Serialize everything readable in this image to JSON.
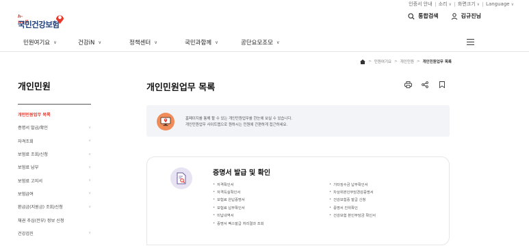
{
  "utility": {
    "cert": "인증서 안내",
    "sound": "소리",
    "zoom": "화면크기",
    "language": "Language"
  },
  "logo": {
    "tagline": "h-well",
    "name": "국민건강보험"
  },
  "header": {
    "search_label": "통합검색",
    "user_label": "김규진님"
  },
  "gnb": {
    "items": [
      "민원여기요",
      "건강iN",
      "정책센터",
      "국민과함께",
      "공단요모조모"
    ]
  },
  "breadcrumb": {
    "items": [
      "민원여기요",
      "개인민원",
      "개인민원업무 목록"
    ]
  },
  "sidebar": {
    "title": "개인민원",
    "items": [
      {
        "label": "개인민원업무 목록",
        "active": true,
        "chevron": false
      },
      {
        "label": "증명서 발급/확인",
        "active": false,
        "chevron": true
      },
      {
        "label": "자격조회",
        "active": false,
        "chevron": true
      },
      {
        "label": "보험료 조회/신청",
        "active": false,
        "chevron": true
      },
      {
        "label": "보험료 납부",
        "active": false,
        "chevron": true
      },
      {
        "label": "보험료 고지서",
        "active": false,
        "chevron": true
      },
      {
        "label": "보험급여",
        "active": false,
        "chevron": true
      },
      {
        "label": "환급금(지원금) 조회/신청",
        "active": false,
        "chevron": true
      },
      {
        "label": "채권 추심(전부) 정보 신청",
        "active": false,
        "chevron": false
      },
      {
        "label": "건강검진",
        "active": false,
        "chevron": true
      }
    ]
  },
  "main": {
    "title": "개인민원업무 목록",
    "notice": {
      "line1": "홈페이지를 통해 할 수 있는 개인민원업무를 한눈에 보실 수 있습니다.",
      "line2": "개인민원업무 사이트맵으로 원하시는 민원에 간편하게 접근하세요."
    },
    "card": {
      "title": "증명서 발급 및 확인",
      "left_items": [
        "자격확인서",
        "자격득실확인서",
        "보험료 완납증명서",
        "보험료 납부확인서",
        "미납내역서",
        "증명서 팩스발급 처리결과 조회"
      ],
      "right_items": [
        "기타징수금 납부확인서",
        "차상위본인부담경감증명서",
        "건강보험증 발급 신청",
        "증명서 진위확인",
        "건강보험 본인부담금 확인서"
      ]
    }
  },
  "colors": {
    "accent_red": "#e8372c",
    "brand_navy": "#1f3e7a",
    "notice_bg": "#f2f4f8",
    "notice_icon": "#f08c5a",
    "card_icon_bg": "#e8e3f3"
  },
  "icons": {
    "search": "search-icon",
    "user": "user-icon",
    "print": "print-icon",
    "share": "share-icon",
    "bookmark": "bookmark-icon",
    "home": "home-icon"
  }
}
